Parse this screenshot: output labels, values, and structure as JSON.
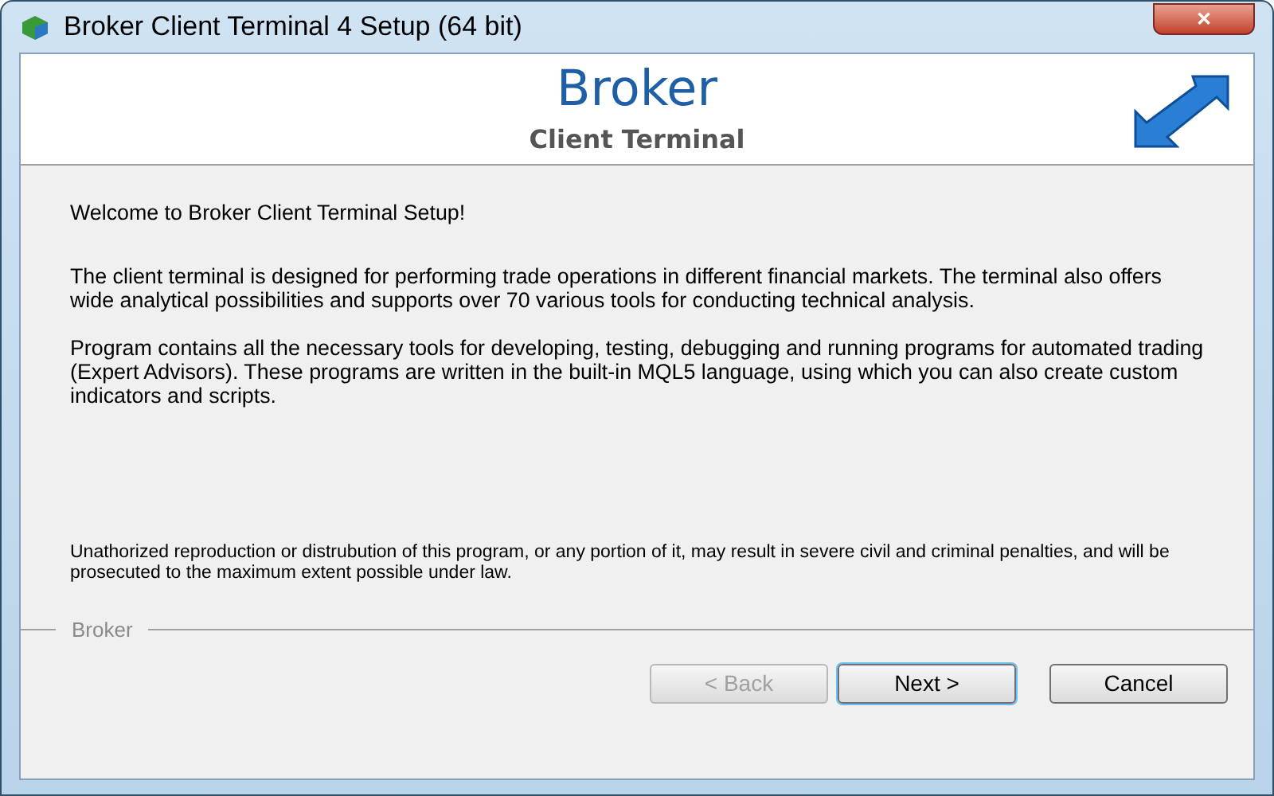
{
  "window": {
    "title": "Broker Client Terminal 4 Setup (64 bit)",
    "close": "✕"
  },
  "header": {
    "brand": "Broker",
    "subtitle": "Client Terminal"
  },
  "welcome": "Welcome to Broker Client Terminal  Setup!",
  "paragraphs": [
    "The client terminal is designed for performing trade operations in different financial markets. The terminal also offers wide analytical possibilities and supports over 70 various tools for conducting technical analysis.",
    "Program contains all the necessary tools for developing, testing, debugging and running programs for automated trading (Expert Advisors). These programs are written in the built-in MQL5 language, using which you can also create custom indicators and scripts."
  ],
  "legal": "Unathorized reproduction or distrubution of this program, or any portion of it, may result in severe civil and criminal penalties, and will be prosecuted to the maximum extent possible under law.",
  "group_label": "Broker",
  "buttons": [
    {
      "label": "< Back",
      "disabled": true,
      "default": false
    },
    {
      "label": "Next >",
      "disabled": false,
      "default": true
    },
    {
      "label": "Cancel",
      "disabled": false,
      "default": false
    }
  ]
}
